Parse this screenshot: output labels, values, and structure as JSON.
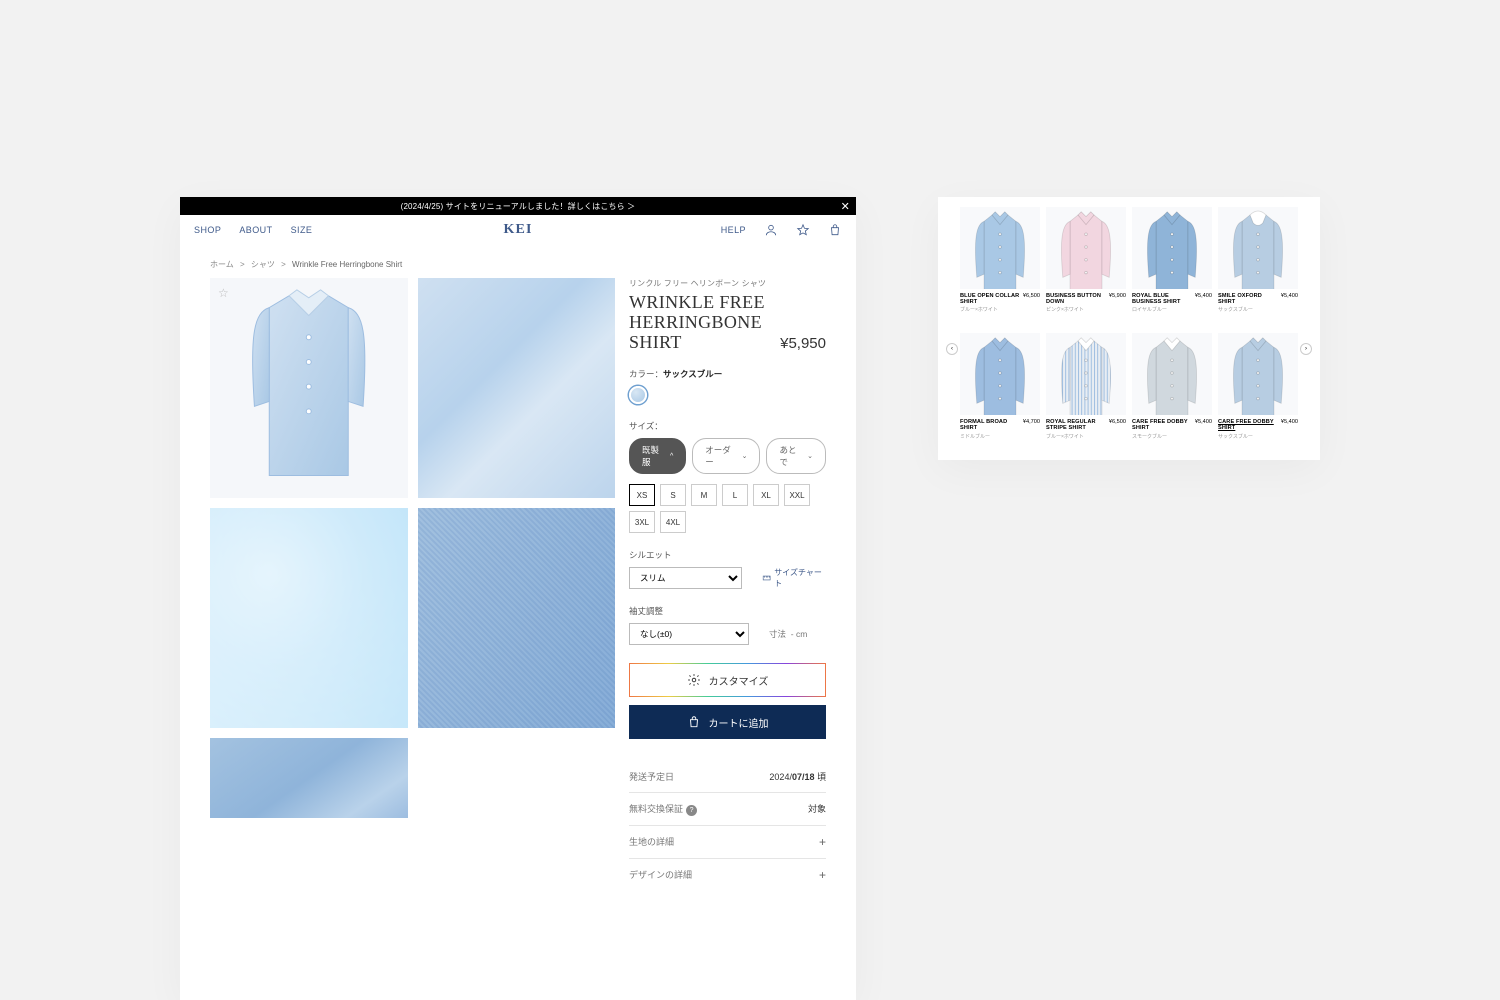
{
  "announce": {
    "text": "(2024/4/25) サイトをリニューアルしました！詳しくはこちら ＞",
    "close": "✕"
  },
  "nav": {
    "shop": "SHOP",
    "about": "ABOUT",
    "size": "SIZE",
    "logo": "KEI",
    "help": "HELP"
  },
  "breadcrumbs": {
    "home": "ホーム",
    "cat": "シャツ",
    "current": "Wrinkle Free Herringbone Shirt",
    "sep": ">"
  },
  "product": {
    "jp_name": "リンクル フリー ヘリンボーン シャツ",
    "en_name": "WRINKLE FREE HERRINGBONE SHIRT",
    "price": "¥5,950",
    "color_label": "カラー：",
    "color_value": "サックスブルー",
    "size_label": "サイズ：",
    "tabs": {
      "stock": "既製服",
      "order": "オーダー",
      "later": "あとで"
    },
    "sizes": [
      "XS",
      "S",
      "M",
      "L",
      "XL",
      "XXL",
      "3XL",
      "4XL"
    ],
    "silhouette_label": "シルエット",
    "silhouette_value": "スリム",
    "size_chart": "サイズチャート",
    "sleeve_label": "袖丈調整",
    "sleeve_value": "なし(±0)",
    "dim_label": "寸法",
    "dim_value": "- cm",
    "customise": "カスタマイズ",
    "cart": "カートに追加",
    "ship_label": "発送予定日",
    "ship_value_pre": "2024/",
    "ship_value_b": "07/18",
    "ship_value_post": " 頃",
    "guarantee_label": "無料交換保証",
    "guarantee_value": "対象",
    "fabric_label": "生地の詳細",
    "design_label": "デザインの詳細"
  },
  "related": [
    {
      "name": "BLUE OPEN COLLAR SHIRT",
      "price": "¥6,500",
      "color": "ブルー×ホワイト",
      "shirtColor": "#a9c8e5",
      "collarColor": "#a9c8e5"
    },
    {
      "name": "BUSINESS BUTTON DOWN",
      "price": "¥5,900",
      "color": "ピンク×ホワイト",
      "shirtColor": "#f2d6e0",
      "collarColor": "#f2d6e0"
    },
    {
      "name": "ROYAL BLUE BUSINESS SHIRT",
      "price": "¥5,400",
      "color": "ロイヤルブルー",
      "shirtColor": "#8fb4d8",
      "collarColor": "#8fb4d8"
    },
    {
      "name": "SMILE OXFORD SHIRT",
      "price": "¥5,400",
      "color": "サックスブルー",
      "shirtColor": "#b7cde2",
      "collarColor": "#ffffff",
      "round": true
    },
    {
      "name": "FORMAL BROAD SHIRT",
      "price": "¥4,700",
      "color": "ミドルブルー",
      "shirtColor": "#9dbde0",
      "collarColor": "#9dbde0"
    },
    {
      "name": "ROYAL REGULAR STRIPE SHIRT",
      "price": "¥6,500",
      "color": "ブルー×ホワイト",
      "shirtColor": "stripe",
      "collarColor": "#ffffff"
    },
    {
      "name": "CARE FREE DOBBY SHIRT",
      "price": "¥5,400",
      "color": "スモークブルー",
      "shirtColor": "#d0d8de",
      "collarColor": "#ffffff"
    },
    {
      "name": "CARE FREE DOBBY SHIRT",
      "price": "¥5,400",
      "color": "サックスブルー",
      "shirtColor": "#b7cde2",
      "collarColor": "#b7cde2",
      "underline": true
    }
  ]
}
